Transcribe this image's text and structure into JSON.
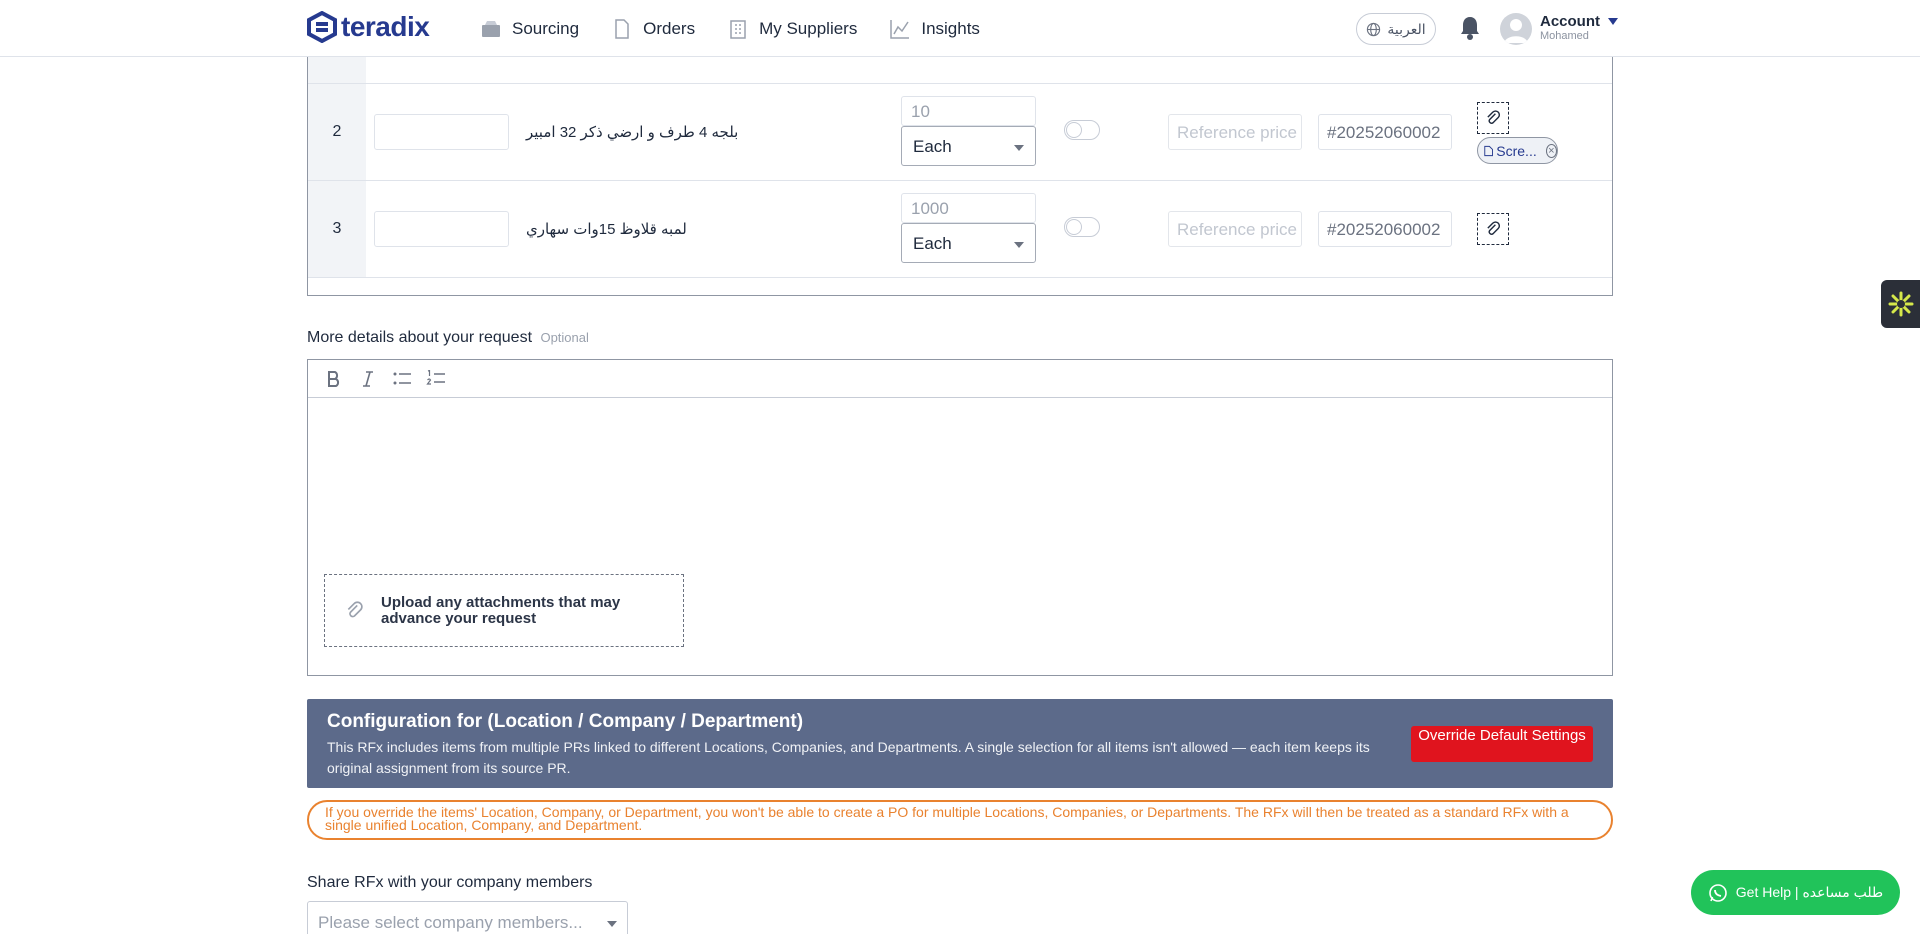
{
  "header": {
    "logo_text": "teradix",
    "nav": [
      {
        "label": "Sourcing",
        "icon": "box-icon"
      },
      {
        "label": "Orders",
        "icon": "document-icon"
      },
      {
        "label": "My Suppliers",
        "icon": "building-icon"
      },
      {
        "label": "Insights",
        "icon": "chart-icon"
      }
    ],
    "language_label": "العربية",
    "account_label": "Account",
    "account_user": "Mohamed"
  },
  "items": [
    {
      "number": "2",
      "name": "بلجه 4 طرف و ارضي ذكر 32 امبير",
      "quantity": "10",
      "unit": "Each",
      "reference_placeholder": "Reference price",
      "pr_number": "#20252060002",
      "attachment": "Scre..."
    },
    {
      "number": "3",
      "name": "لمبه قلاوظ 15وات سهاري",
      "quantity": "1000",
      "unit": "Each",
      "reference_placeholder": "Reference price",
      "pr_number": "#20252060002"
    }
  ],
  "details": {
    "label": "More details about your request",
    "optional": "Optional",
    "upload_text": "Upload any attachments that may advance your request"
  },
  "config": {
    "title": "Configuration for (Location / Company / Department)",
    "description": "This RFx includes items from multiple PRs linked to different Locations, Companies, and Departments. A single selection for all items isn't allowed — each item keeps its original assignment from its source PR.",
    "override_label": "Override Default Settings",
    "warning": "If you override the items' Location, Company, or Department, you won't be able to create a PO for multiple Locations, Companies, or Departments. The RFx will then be treated as a standard RFx with a single unified Location, Company, and Department."
  },
  "share": {
    "label": "Share RFx with your company members",
    "placeholder": "Please select company members..."
  },
  "help": {
    "label": "Get Help | طلب مساعده"
  },
  "colors": {
    "brand": "#263a8f",
    "banner": "#5c6a8a",
    "danger": "#e0141e",
    "warning": "#e9822f",
    "whatsapp": "#21c35a"
  }
}
